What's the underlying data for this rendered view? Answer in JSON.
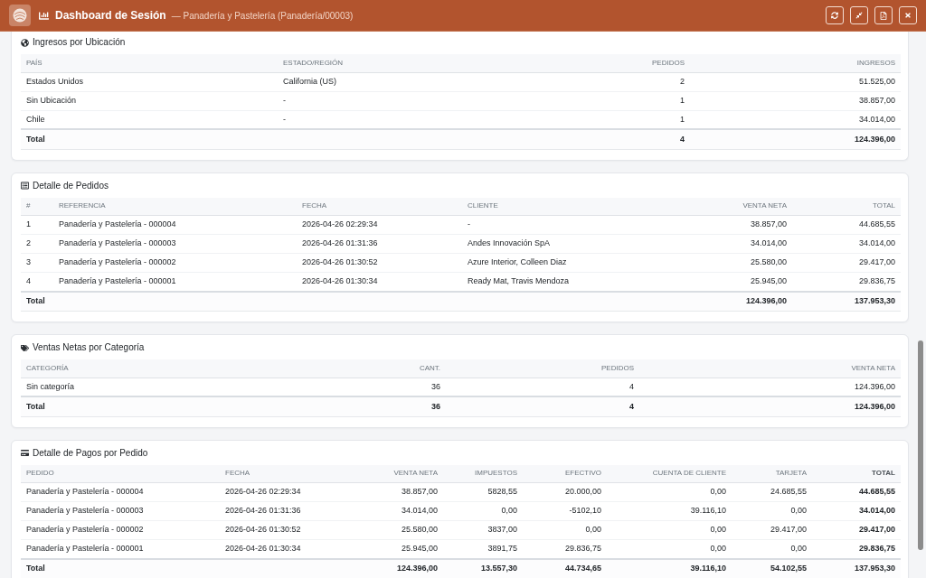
{
  "header": {
    "title": "Dashboard de Sesión",
    "subtitle": "— Panadería y Pastelería (Panadería/00003)"
  },
  "sections": [
    {
      "title": "Ingresos por Ubicación",
      "columns": [
        "PAÍS",
        "ESTADO/REGIÓN",
        "PEDIDOS",
        "INGRESOS"
      ],
      "rows": [
        [
          "Estados Unidos",
          "California (US)",
          "2",
          "51.525,00"
        ],
        [
          "Sin Ubicación",
          "-",
          "1",
          "38.857,00"
        ],
        [
          "Chile",
          "-",
          "1",
          "34.014,00"
        ]
      ],
      "total": {
        "label": "Total",
        "values": [
          "4",
          "124.396,00"
        ]
      }
    },
    {
      "title": "Detalle de Pedidos",
      "columns": [
        "#",
        "REFERENCIA",
        "FECHA",
        "CLIENTE",
        "VENTA NETA",
        "TOTAL"
      ],
      "rows": [
        [
          "1",
          "Panadería y Pastelería - 000004",
          "2026-04-26 02:29:34",
          "-",
          "38.857,00",
          "44.685,55"
        ],
        [
          "2",
          "Panadería y Pastelería - 000003",
          "2026-04-26 01:31:36",
          "Andes Innovación SpA",
          "34.014,00",
          "34.014,00"
        ],
        [
          "3",
          "Panadería y Pastelería - 000002",
          "2026-04-26 01:30:52",
          "Azure Interior, Colleen Diaz",
          "25.580,00",
          "29.417,00"
        ],
        [
          "4",
          "Panadería y Pastelería - 000001",
          "2026-04-26 01:30:34",
          "Ready Mat, Travis Mendoza",
          "25.945,00",
          "29.836,75"
        ]
      ],
      "total": {
        "label": "Total",
        "values": [
          "124.396,00",
          "137.953,30"
        ]
      }
    },
    {
      "title": "Ventas Netas por Categoría",
      "columns": [
        "CATEGORÍA",
        "CANT.",
        "PEDIDOS",
        "VENTA NETA"
      ],
      "rows": [
        [
          "Sin categoría",
          "36",
          "4",
          "124.396,00"
        ]
      ],
      "total": {
        "label": "Total",
        "values": [
          "36",
          "4",
          "124.396,00"
        ]
      }
    },
    {
      "title": "Detalle de Pagos por Pedido",
      "columns": [
        "PEDIDO",
        "FECHA",
        "VENTA NETA",
        "IMPUESTOS",
        "EFECTIVO",
        "CUENTA DE CLIENTE",
        "TARJETA",
        "TOTAL"
      ],
      "rows": [
        [
          "Panadería y Pastelería - 000004",
          "2026-04-26 02:29:34",
          "38.857,00",
          "5828,55",
          "20.000,00",
          "0,00",
          "24.685,55",
          "44.685,55"
        ],
        [
          "Panadería y Pastelería - 000003",
          "2026-04-26 01:31:36",
          "34.014,00",
          "0,00",
          "-5102,10",
          "39.116,10",
          "0,00",
          "34.014,00"
        ],
        [
          "Panadería y Pastelería - 000002",
          "2026-04-26 01:30:52",
          "25.580,00",
          "3837,00",
          "0,00",
          "0,00",
          "29.417,00",
          "29.417,00"
        ],
        [
          "Panadería y Pastelería - 000001",
          "2026-04-26 01:30:34",
          "25.945,00",
          "3891,75",
          "29.836,75",
          "0,00",
          "0,00",
          "29.836,75"
        ]
      ],
      "total": {
        "label": "Total",
        "values": [
          "124.396,00",
          "13.557,30",
          "44.734,65",
          "39.116,10",
          "54.102,55",
          "137.953,30"
        ]
      }
    }
  ]
}
